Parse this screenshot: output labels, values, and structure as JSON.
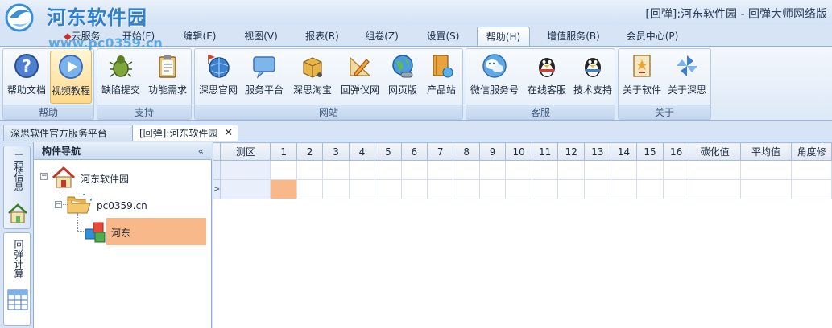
{
  "window": {
    "title": "[回弹]:河东软件园 - 回弹大师网络版",
    "brand": "河东软件园",
    "watermark": "www.pc0359.cn"
  },
  "menu": {
    "tabs": [
      {
        "label": "云服务"
      },
      {
        "label": "开始(F)"
      },
      {
        "label": "编辑(E)"
      },
      {
        "label": "视图(V)"
      },
      {
        "label": "报表(R)"
      },
      {
        "label": "组卷(Z)"
      },
      {
        "label": "设置(S)"
      },
      {
        "label": "帮助(H)",
        "active": true
      },
      {
        "label": "增值服务(B)"
      },
      {
        "label": "会员中心(P)"
      }
    ]
  },
  "ribbon": {
    "groups": [
      {
        "label": "帮助",
        "buttons": [
          {
            "label": "帮助文档",
            "icon": "help-icon"
          },
          {
            "label": "视频教程",
            "icon": "play-video-icon",
            "highlighted": true
          }
        ]
      },
      {
        "label": "支持",
        "buttons": [
          {
            "label": "缺陷提交",
            "icon": "bug-icon"
          },
          {
            "label": "功能需求",
            "icon": "clipboard-icon"
          }
        ]
      },
      {
        "label": "网站",
        "buttons": [
          {
            "label": "深思官网",
            "icon": "globe-flag-icon"
          },
          {
            "label": "服务平台",
            "icon": "chat-bubble-icon"
          },
          {
            "label": "深思淘宝",
            "icon": "shopping-box-icon"
          },
          {
            "label": "回弹仪网",
            "icon": "pencil-ruler-icon"
          },
          {
            "label": "网页版",
            "icon": "web-globe-icon"
          },
          {
            "label": "产品站",
            "icon": "product-book-icon"
          }
        ]
      },
      {
        "label": "客服",
        "buttons": [
          {
            "label": "微信服务号",
            "icon": "wechat-icon"
          },
          {
            "label": "在线客服",
            "icon": "qq-penguin-icon"
          },
          {
            "label": "技术支持",
            "icon": "qq-penguin-icon"
          }
        ]
      },
      {
        "label": "关于",
        "buttons": [
          {
            "label": "关于软件",
            "icon": "star-certificate-icon"
          },
          {
            "label": "关于深思",
            "icon": "pinwheel-icon"
          }
        ]
      }
    ]
  },
  "doc_tabs": [
    {
      "label": "深思软件官方服务平台",
      "active": false
    },
    {
      "label": "[回弹]:河东软件园",
      "active": true,
      "close": "✕"
    }
  ],
  "side_tabs": [
    {
      "label": "工程信息",
      "icon": "house-icon",
      "selected": false
    },
    {
      "label": "回弹计算",
      "icon": "calculator-grid-icon",
      "selected": true
    }
  ],
  "navigator": {
    "title": "构件导航",
    "collapse": "«",
    "tree": {
      "root": {
        "label": "河东软件园",
        "icon": "house-icon",
        "expander": "−"
      },
      "child": {
        "label": "pc0359.cn",
        "icon": "folder-open-icon",
        "expander": "−"
      },
      "leaf": {
        "label": "河东",
        "icon": "component-cubes-icon",
        "selected": true
      }
    }
  },
  "grid": {
    "columns": [
      "测区",
      "1",
      "2",
      "3",
      "4",
      "5",
      "6",
      "7",
      "8",
      "9",
      "10",
      "11",
      "12",
      "13",
      "14",
      "15",
      "16",
      "碳化值",
      "平均值",
      "角度修"
    ],
    "row_markers": [
      "",
      ">"
    ],
    "selected_cell": {
      "row": 1,
      "column": "1"
    }
  },
  "colors": {
    "accent": "#2c7fd1",
    "selection": "#f8b88a",
    "ribbon_highlight": "#ffd98a"
  }
}
